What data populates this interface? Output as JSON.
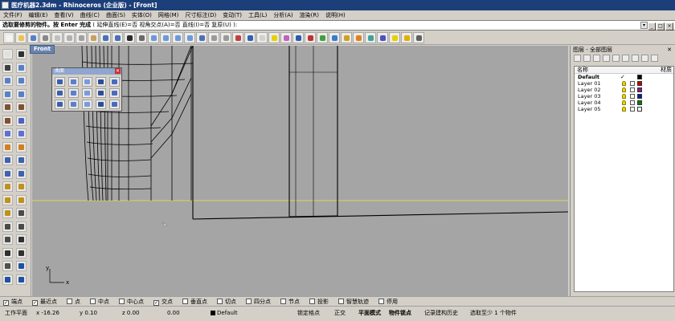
{
  "window": {
    "title": "医疗机器2.3dm - Rhinoceros (企业版) - [Front]",
    "controls": [
      "minimize-icon",
      "maximize-icon",
      "close-icon"
    ]
  },
  "menu": [
    "文件(F)",
    "编辑(E)",
    "查看(V)",
    "曲线(C)",
    "曲面(S)",
    "实体(O)",
    "网格(M)",
    "尺寸标注(D)",
    "变动(T)",
    "工具(L)",
    "分析(A)",
    "渲染(R)",
    "说明(H)"
  ],
  "command": {
    "prompt": "选取要修剪的物件。按 Enter 完成",
    "options": "( 延伸直线(E)=否  视角交点(A)=否  直线(I)=否  复原(U) ):"
  },
  "viewport": {
    "label": "Front",
    "background": "#a5a5a5",
    "axis_x": "x",
    "axis_y": "y",
    "grid_line_color": "#d8d860"
  },
  "float_panel": {
    "title": "曲面",
    "close_label": "✕"
  },
  "layers": {
    "title": "图层 - 全部图层",
    "close_label": "✕",
    "col_name": "名称",
    "col_material": "材质",
    "rows": [
      {
        "name": "Default",
        "current": "✓",
        "color": "#000000",
        "bold": true
      },
      {
        "name": "Layer 01",
        "color": "#c00000"
      },
      {
        "name": "Layer 02",
        "color": "#8b1a8b"
      },
      {
        "name": "Layer 03",
        "color": "#0a1f8f"
      },
      {
        "name": "Layer 04",
        "color": "#0b7a0b"
      },
      {
        "name": "Layer 05",
        "color": "#ffffff"
      }
    ]
  },
  "osnaps": [
    {
      "label": "端点",
      "checked": true
    },
    {
      "label": "最近点",
      "checked": true
    },
    {
      "label": "点",
      "checked": false
    },
    {
      "label": "中点",
      "checked": false
    },
    {
      "label": "中心点",
      "checked": false
    },
    {
      "label": "交点",
      "checked": true
    },
    {
      "label": "垂直点",
      "checked": false
    },
    {
      "label": "切点",
      "checked": false
    },
    {
      "label": "四分点",
      "checked": false
    },
    {
      "label": "节点",
      "checked": false
    },
    {
      "label": "投影",
      "checked": false
    },
    {
      "label": "智慧轨迹",
      "checked": false
    },
    {
      "label": "停用",
      "checked": false
    }
  ],
  "status": {
    "cplane": "工作平面",
    "x": "x -16.26",
    "y": "y 0.10",
    "z": "z 0.00",
    "value": "0.00",
    "layer": "Default",
    "grid_snap": "锁定格点",
    "ortho": "正交",
    "planar": "平面模式",
    "osnap": "物件锁点",
    "history": "记录建构历史",
    "selection": "选取至少 1 个物件"
  }
}
